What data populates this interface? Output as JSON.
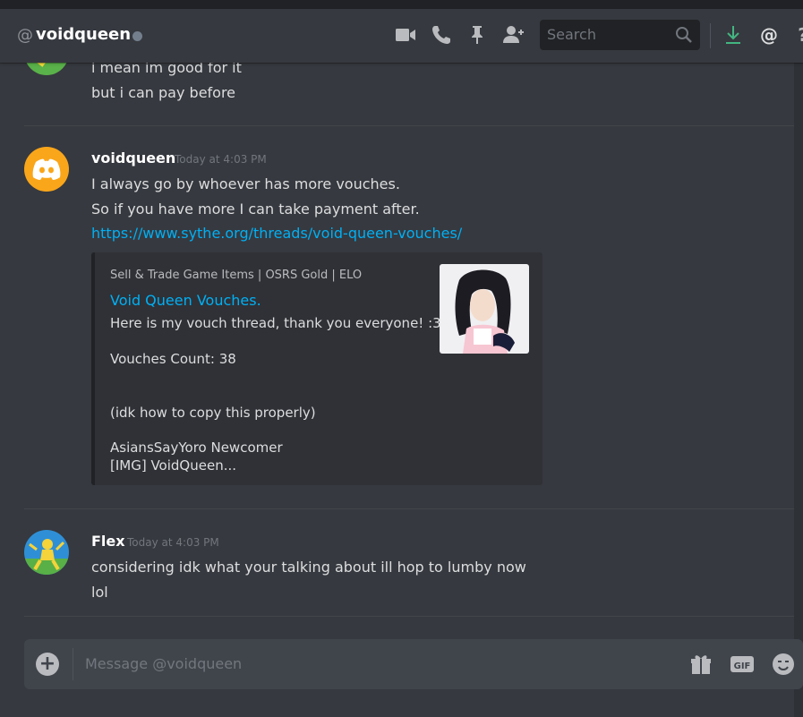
{
  "header": {
    "at_symbol": "@",
    "username": "voidqueen",
    "search_placeholder": "Search"
  },
  "messages": {
    "prev": {
      "line1": "i mean im good for it",
      "line2": "but i can pay before"
    },
    "voidqueen": {
      "author": "voidqueen",
      "timestamp": "Today at 4:03 PM",
      "line1": "I always go by whoever has more vouches.",
      "line2": "So if you have more I can take payment after.",
      "link": "https://www.sythe.org/threads/void-queen-vouches/",
      "embed": {
        "provider": "Sell & Trade Game Items | OSRS Gold | ELO",
        "title": "Void Queen Vouches.",
        "desc1": "Here is my vouch thread, thank you everyone! :3",
        "desc2": "Vouches Count: 38",
        "desc3": "(idk how to copy this properly)",
        "desc4": "AsiansSayYoro Newcomer",
        "desc5": "[IMG] VoidQueen..."
      }
    },
    "flex": {
      "author": "Flex",
      "timestamp": "Today at 4:03 PM",
      "line1": "considering idk what your talking about ill hop to lumby now",
      "line2": "lol"
    }
  },
  "composer": {
    "placeholder": "Message @voidqueen",
    "gif_label": "GIF"
  },
  "colors": {
    "background": "#36393f",
    "link": "#00b0f4",
    "status_offline": "#747f8d",
    "download_green": "#43b581",
    "avatar_discord_orange": "#faa61a"
  }
}
